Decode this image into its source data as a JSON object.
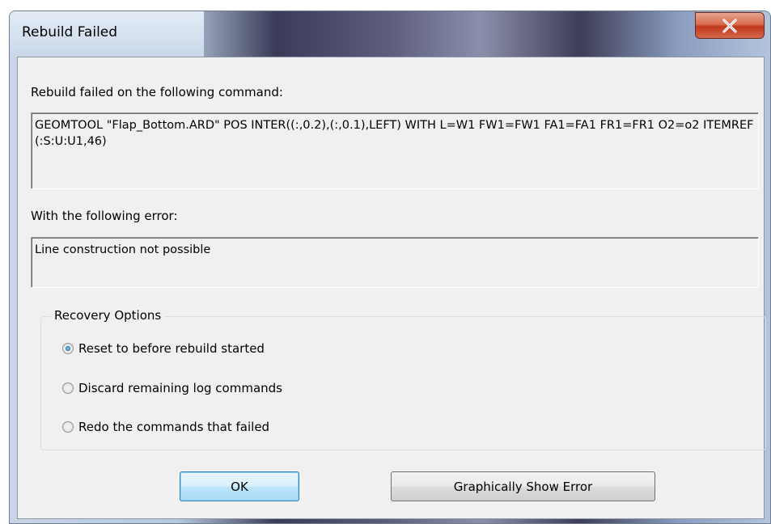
{
  "window": {
    "title": "Rebuild Failed"
  },
  "command_section": {
    "label": "Rebuild failed on the following command:",
    "text": "GEOMTOOL \"Flap_Bottom.ARD\" POS INTER((:,0.2),(:,0.1),LEFT) WITH L=W1 FW1=FW1 FA1=FA1 FR1=FR1 O2=o2 ITEMREF (:S:U:U1,46)"
  },
  "error_section": {
    "label": "With the following error:",
    "text": "Line construction not possible"
  },
  "recovery": {
    "title": "Recovery Options",
    "options": [
      {
        "label": "Reset to before rebuild started",
        "checked": true
      },
      {
        "label": "Discard remaining log commands",
        "checked": false
      },
      {
        "label": "Redo the commands that failed",
        "checked": false
      }
    ]
  },
  "buttons": {
    "ok": "OK",
    "show_error": "Graphically Show Error"
  },
  "colors": {
    "close_button": "#c7422a",
    "dialog_bg": "#f0f0f0"
  },
  "icons": {
    "close": "close-icon",
    "radio": "radio-icon"
  }
}
